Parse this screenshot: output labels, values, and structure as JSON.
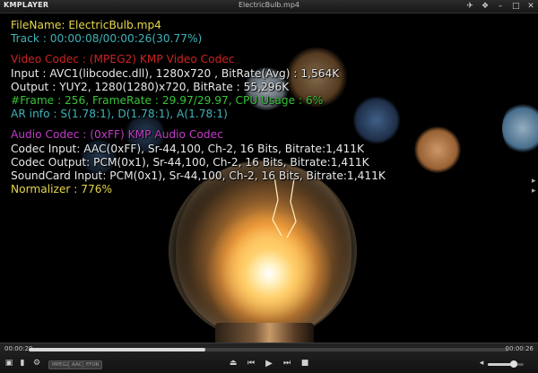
{
  "app": {
    "logo": "KMPLAYER",
    "window_title": "ElectricBulb.mp4"
  },
  "window_controls": [
    {
      "name": "pin-icon",
      "glyph": "✈"
    },
    {
      "name": "skin-icon",
      "glyph": "❖"
    },
    {
      "name": "minimize-icon",
      "glyph": "—"
    },
    {
      "name": "maximize-icon",
      "glyph": "□"
    },
    {
      "name": "close-icon",
      "glyph": "✕"
    }
  ],
  "colors": {
    "yellow": "#e6d64a",
    "cyan": "#3fb3b8",
    "red": "#cc2222",
    "white": "#e8e8e8",
    "green": "#38c238",
    "magenta": "#c23cc8",
    "blue": "#3c88c8"
  },
  "osd": {
    "filename": "FileName: ElectricBulb.mp4",
    "track": "Track : 00:00:08/00:00:26(30.77%)",
    "video_codec": "Video Codec : (MPEG2) KMP Video Codec",
    "input": "Input : AVC1(libcodec.dll), 1280x720 , BitRate(Avg) : 1,564K",
    "output": "Output : YUY2, 1280(1280)x720, BitRate : 55,296K",
    "frame": "#Frame : 256, FrameRate : 29.97/29.97, CPU Usage : 6%",
    "ar_info": "AR info : S(1.78:1), D(1.78:1), A(1.78:1)",
    "audio_codec": "Audio Codec : (0xFF) KMP Audio Codec",
    "codec_input": "Codec Input: AAC(0xFF), Sr-44,100, Ch-2, 16 Bits, Bitrate:1,411K",
    "codec_output": "Codec Output: PCM(0x1), Sr-44,100, Ch-2, 16 Bits, Bitrate:1,411K",
    "soundcard_input": "SoundCard Input: PCM(0x1), Sr-44,100, Ch-2, 16 Bits, Bitrate:1,411K",
    "normalizer": "Normalizer : 776%"
  },
  "playback": {
    "elapsed": "00:00:29",
    "total": "00:00:26",
    "progress": 0.3677
  },
  "toolbar": {
    "chips": [
      "MPEG2",
      "AAC",
      "FFOR"
    ],
    "volume": 0.72
  }
}
